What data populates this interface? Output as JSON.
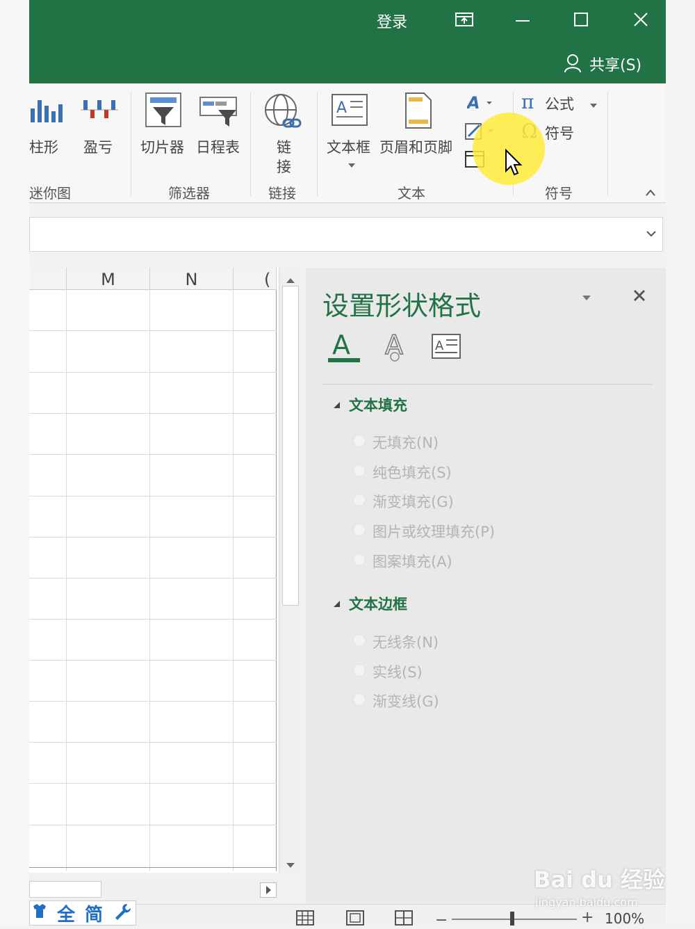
{
  "titlebar": {
    "login": "登录",
    "share": "共享(S)",
    "accent_color": "#217346"
  },
  "ribbon": {
    "sparkline_column": "柱形",
    "sparkline_winloss": "盈亏",
    "sparkline_group": "迷你图",
    "slicer": "切片器",
    "timeline": "日程表",
    "filter_group": "筛选器",
    "link_label_1": "链",
    "link_label_2": "接",
    "link_group": "链接",
    "textbox": "文本框",
    "header_footer": "页眉和页脚",
    "text_group": "文本",
    "equation": "公式",
    "symbol": "符号",
    "symbol_group": "符号"
  },
  "sheet": {
    "columns": [
      "M",
      "N",
      "("
    ]
  },
  "pane": {
    "title": "设置形状格式",
    "fill_section": "文本填充",
    "fill_options": [
      "无填充(N)",
      "纯色填充(S)",
      "渐变填充(G)",
      "图片或纹理填充(P)",
      "图案填充(A)"
    ],
    "border_section": "文本边框",
    "border_options": [
      "无线条(N)",
      "实线(S)",
      "渐变线(G)"
    ]
  },
  "statusbar": {
    "zoom": "100%",
    "ime_full": "全",
    "ime_simplified": "简"
  },
  "watermark": {
    "brand": "Bai du 经验",
    "url": "jingyan.baidu.com"
  }
}
